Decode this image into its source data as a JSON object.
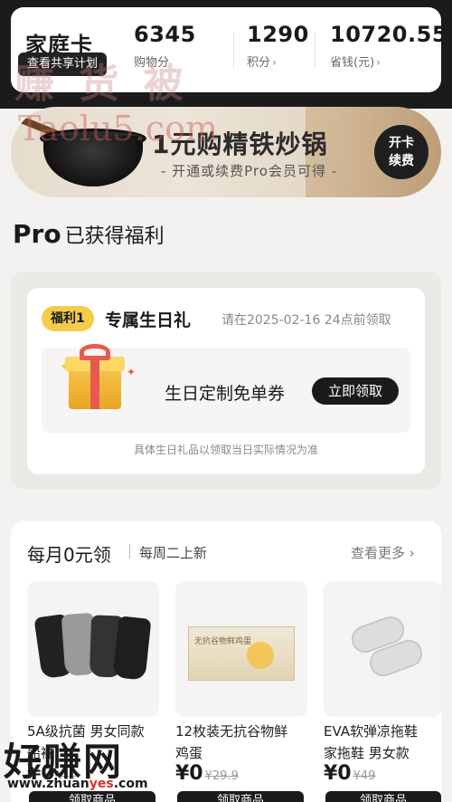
{
  "header": {
    "card_name": "家庭卡",
    "share_plan": "查看共享计划",
    "stats": [
      {
        "value": "6345",
        "label": "购物分"
      },
      {
        "value": "1290",
        "label": "积分",
        "chevron": "›"
      },
      {
        "value": "10720.55",
        "label": "省钱(元)",
        "chevron": "›"
      }
    ]
  },
  "banner": {
    "title": "1元购精铁炒锅",
    "subtitle": "- 开通或续费Pro会员可得 -",
    "button_line1": "开卡",
    "button_line2": "续费"
  },
  "section": {
    "pro": "Pro",
    "title_rest": "已获得福利"
  },
  "benefit": {
    "tag": "福利1",
    "name": "专属生日礼",
    "deadline": "请在2025-02-16 24点前领取",
    "gift_title": "生日定制免单券",
    "claim_button": "立即领取",
    "note": "具体生日礼品以领取当日实际情况为准"
  },
  "monthly": {
    "title": "每月0元领",
    "subtitle": "每周二上新",
    "see_more": "查看更多 ›",
    "products": [
      {
        "name_line1": "5A级抗菌 男女同款",
        "name_line2": "船袜",
        "price": "¥0",
        "original": "¥…",
        "button": "领取商品"
      },
      {
        "name_line1": "12枚装无抗谷物鲜",
        "name_line2": "鸡蛋",
        "price": "¥0",
        "original": "¥29.9",
        "button": "领取商品",
        "box_label": "无抗谷物鲜鸡蛋"
      },
      {
        "name_line1": "EVA软弹凉拖鞋",
        "name_line2": "家拖鞋 男女款",
        "price": "¥0",
        "original": "¥49",
        "button": "领取商品"
      }
    ]
  },
  "watermarks": {
    "top_text": "赚 货 被",
    "top_url": "Taolu5.com",
    "bottom_text": "好赚网",
    "bottom_url_a": "www.zhuan",
    "bottom_url_b": "yes",
    "bottom_url_c": ".com"
  },
  "colors": {
    "dark": "#1b1b1b",
    "tag_yellow": "#f5cc49",
    "page_bg": "#f3f2f0"
  }
}
